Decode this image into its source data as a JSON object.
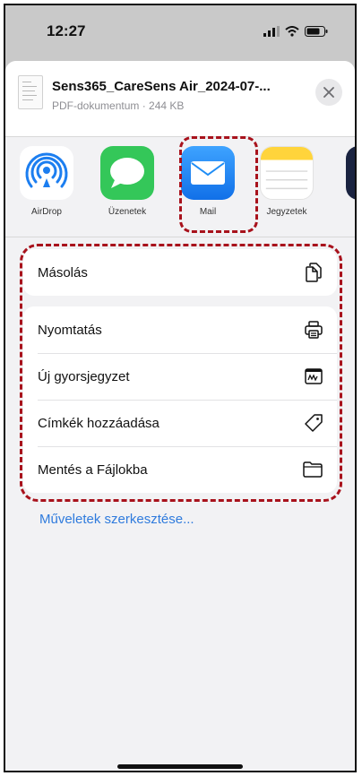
{
  "status": {
    "time": "12:27"
  },
  "document": {
    "title": "Sens365_CareSens Air_2024-07-...",
    "subtitle": "PDF-dokumentum · 244 KB"
  },
  "apps": [
    {
      "label": "AirDrop",
      "icon": "airdrop-icon",
      "color": "#1c7ef0"
    },
    {
      "label": "Üzenetek",
      "icon": "messages-icon",
      "color": "#34c759"
    },
    {
      "label": "Mail",
      "icon": "mail-icon",
      "color": "#1f8df5"
    },
    {
      "label": "Jegyzetek",
      "icon": "notes-icon",
      "color": "#ffd43b"
    }
  ],
  "actions": {
    "copy": {
      "label": "Másolás",
      "icon": "copy-icon"
    },
    "print": {
      "label": "Nyomtatás",
      "icon": "print-icon"
    },
    "quick_note": {
      "label": "Új gyorsjegyzet",
      "icon": "quick-note-icon"
    },
    "add_tags": {
      "label": "Címkék hozzáadása",
      "icon": "tag-icon"
    },
    "save_files": {
      "label": "Mentés a Fájlokba",
      "icon": "folder-icon"
    }
  },
  "edit_actions": "Műveletek szerkesztése...",
  "annotation_color": "#a8121c",
  "link_color": "#2f7bdd"
}
